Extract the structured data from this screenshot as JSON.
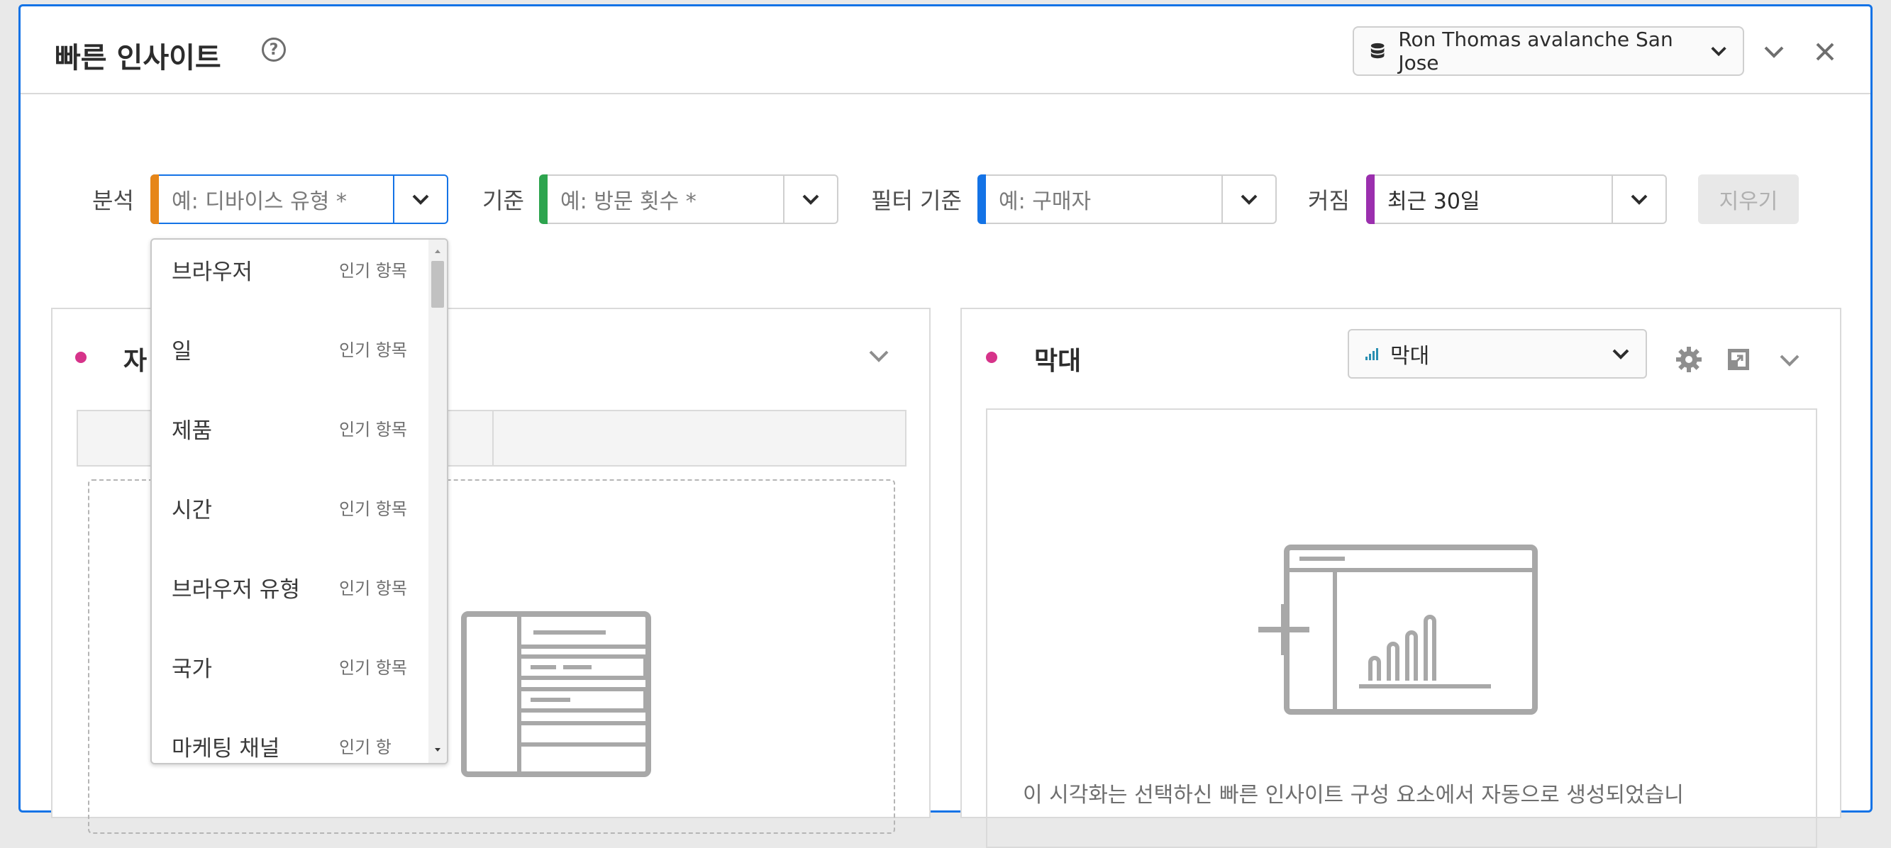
{
  "panel": {
    "title": "빠른 인사이트",
    "help_icon": "help-circle-icon",
    "report_suite": "Ron Thomas avalanche San Jose"
  },
  "filters": {
    "analyze": {
      "label": "분석",
      "placeholder": "예: 디바이스 유형 *",
      "color": "#e68619"
    },
    "by": {
      "label": "기준",
      "placeholder": "예: 방문 횟수 *",
      "color": "#2da44e"
    },
    "filter_by": {
      "label": "필터 기준",
      "placeholder": "예: 구매자",
      "color": "#1473e6"
    },
    "over": {
      "label": "커짐",
      "value": "최근 30일",
      "color": "#9b2fae"
    },
    "clear_label": "지우기"
  },
  "dropdown": {
    "items": [
      {
        "name": "브라우저",
        "tag": "인기 항목"
      },
      {
        "name": "일",
        "tag": "인기 항목"
      },
      {
        "name": "제품",
        "tag": "인기 항목"
      },
      {
        "name": "시간",
        "tag": "인기 항목"
      },
      {
        "name": "브라우저 유형",
        "tag": "인기 항목"
      },
      {
        "name": "국가",
        "tag": "인기 항목"
      },
      {
        "name": "마케팅 채널",
        "tag": "인기 항"
      }
    ]
  },
  "left_card": {
    "title": "자"
  },
  "right_card": {
    "title": "막대",
    "viz_type": "막대",
    "message": "이 시각화는 선택하신 빠른 인사이트 구성 요소에서 자동으로 생성되었습니"
  },
  "colors": {
    "accent": "#1473e6",
    "dot": "#d6338a"
  }
}
